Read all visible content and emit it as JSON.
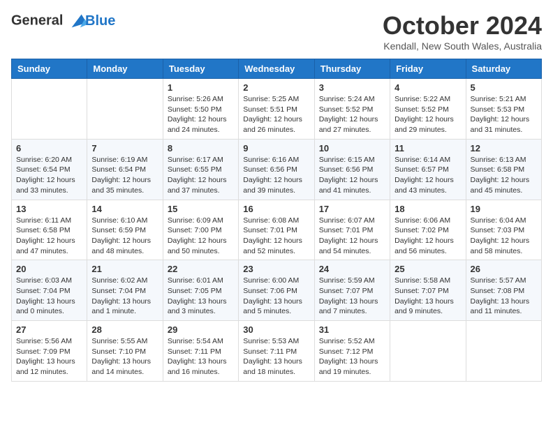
{
  "header": {
    "logo_line1": "General",
    "logo_line2": "Blue",
    "month": "October 2024",
    "location": "Kendall, New South Wales, Australia"
  },
  "weekdays": [
    "Sunday",
    "Monday",
    "Tuesday",
    "Wednesday",
    "Thursday",
    "Friday",
    "Saturday"
  ],
  "weeks": [
    [
      {
        "day": "",
        "sunrise": "",
        "sunset": "",
        "daylight": ""
      },
      {
        "day": "",
        "sunrise": "",
        "sunset": "",
        "daylight": ""
      },
      {
        "day": "1",
        "sunrise": "Sunrise: 5:26 AM",
        "sunset": "Sunset: 5:50 PM",
        "daylight": "Daylight: 12 hours and 24 minutes."
      },
      {
        "day": "2",
        "sunrise": "Sunrise: 5:25 AM",
        "sunset": "Sunset: 5:51 PM",
        "daylight": "Daylight: 12 hours and 26 minutes."
      },
      {
        "day": "3",
        "sunrise": "Sunrise: 5:24 AM",
        "sunset": "Sunset: 5:52 PM",
        "daylight": "Daylight: 12 hours and 27 minutes."
      },
      {
        "day": "4",
        "sunrise": "Sunrise: 5:22 AM",
        "sunset": "Sunset: 5:52 PM",
        "daylight": "Daylight: 12 hours and 29 minutes."
      },
      {
        "day": "5",
        "sunrise": "Sunrise: 5:21 AM",
        "sunset": "Sunset: 5:53 PM",
        "daylight": "Daylight: 12 hours and 31 minutes."
      }
    ],
    [
      {
        "day": "6",
        "sunrise": "Sunrise: 6:20 AM",
        "sunset": "Sunset: 6:54 PM",
        "daylight": "Daylight: 12 hours and 33 minutes."
      },
      {
        "day": "7",
        "sunrise": "Sunrise: 6:19 AM",
        "sunset": "Sunset: 6:54 PM",
        "daylight": "Daylight: 12 hours and 35 minutes."
      },
      {
        "day": "8",
        "sunrise": "Sunrise: 6:17 AM",
        "sunset": "Sunset: 6:55 PM",
        "daylight": "Daylight: 12 hours and 37 minutes."
      },
      {
        "day": "9",
        "sunrise": "Sunrise: 6:16 AM",
        "sunset": "Sunset: 6:56 PM",
        "daylight": "Daylight: 12 hours and 39 minutes."
      },
      {
        "day": "10",
        "sunrise": "Sunrise: 6:15 AM",
        "sunset": "Sunset: 6:56 PM",
        "daylight": "Daylight: 12 hours and 41 minutes."
      },
      {
        "day": "11",
        "sunrise": "Sunrise: 6:14 AM",
        "sunset": "Sunset: 6:57 PM",
        "daylight": "Daylight: 12 hours and 43 minutes."
      },
      {
        "day": "12",
        "sunrise": "Sunrise: 6:13 AM",
        "sunset": "Sunset: 6:58 PM",
        "daylight": "Daylight: 12 hours and 45 minutes."
      }
    ],
    [
      {
        "day": "13",
        "sunrise": "Sunrise: 6:11 AM",
        "sunset": "Sunset: 6:58 PM",
        "daylight": "Daylight: 12 hours and 47 minutes."
      },
      {
        "day": "14",
        "sunrise": "Sunrise: 6:10 AM",
        "sunset": "Sunset: 6:59 PM",
        "daylight": "Daylight: 12 hours and 48 minutes."
      },
      {
        "day": "15",
        "sunrise": "Sunrise: 6:09 AM",
        "sunset": "Sunset: 7:00 PM",
        "daylight": "Daylight: 12 hours and 50 minutes."
      },
      {
        "day": "16",
        "sunrise": "Sunrise: 6:08 AM",
        "sunset": "Sunset: 7:01 PM",
        "daylight": "Daylight: 12 hours and 52 minutes."
      },
      {
        "day": "17",
        "sunrise": "Sunrise: 6:07 AM",
        "sunset": "Sunset: 7:01 PM",
        "daylight": "Daylight: 12 hours and 54 minutes."
      },
      {
        "day": "18",
        "sunrise": "Sunrise: 6:06 AM",
        "sunset": "Sunset: 7:02 PM",
        "daylight": "Daylight: 12 hours and 56 minutes."
      },
      {
        "day": "19",
        "sunrise": "Sunrise: 6:04 AM",
        "sunset": "Sunset: 7:03 PM",
        "daylight": "Daylight: 12 hours and 58 minutes."
      }
    ],
    [
      {
        "day": "20",
        "sunrise": "Sunrise: 6:03 AM",
        "sunset": "Sunset: 7:04 PM",
        "daylight": "Daylight: 13 hours and 0 minutes."
      },
      {
        "day": "21",
        "sunrise": "Sunrise: 6:02 AM",
        "sunset": "Sunset: 7:04 PM",
        "daylight": "Daylight: 13 hours and 1 minute."
      },
      {
        "day": "22",
        "sunrise": "Sunrise: 6:01 AM",
        "sunset": "Sunset: 7:05 PM",
        "daylight": "Daylight: 13 hours and 3 minutes."
      },
      {
        "day": "23",
        "sunrise": "Sunrise: 6:00 AM",
        "sunset": "Sunset: 7:06 PM",
        "daylight": "Daylight: 13 hours and 5 minutes."
      },
      {
        "day": "24",
        "sunrise": "Sunrise: 5:59 AM",
        "sunset": "Sunset: 7:07 PM",
        "daylight": "Daylight: 13 hours and 7 minutes."
      },
      {
        "day": "25",
        "sunrise": "Sunrise: 5:58 AM",
        "sunset": "Sunset: 7:07 PM",
        "daylight": "Daylight: 13 hours and 9 minutes."
      },
      {
        "day": "26",
        "sunrise": "Sunrise: 5:57 AM",
        "sunset": "Sunset: 7:08 PM",
        "daylight": "Daylight: 13 hours and 11 minutes."
      }
    ],
    [
      {
        "day": "27",
        "sunrise": "Sunrise: 5:56 AM",
        "sunset": "Sunset: 7:09 PM",
        "daylight": "Daylight: 13 hours and 12 minutes."
      },
      {
        "day": "28",
        "sunrise": "Sunrise: 5:55 AM",
        "sunset": "Sunset: 7:10 PM",
        "daylight": "Daylight: 13 hours and 14 minutes."
      },
      {
        "day": "29",
        "sunrise": "Sunrise: 5:54 AM",
        "sunset": "Sunset: 7:11 PM",
        "daylight": "Daylight: 13 hours and 16 minutes."
      },
      {
        "day": "30",
        "sunrise": "Sunrise: 5:53 AM",
        "sunset": "Sunset: 7:11 PM",
        "daylight": "Daylight: 13 hours and 18 minutes."
      },
      {
        "day": "31",
        "sunrise": "Sunrise: 5:52 AM",
        "sunset": "Sunset: 7:12 PM",
        "daylight": "Daylight: 13 hours and 19 minutes."
      },
      {
        "day": "",
        "sunrise": "",
        "sunset": "",
        "daylight": ""
      },
      {
        "day": "",
        "sunrise": "",
        "sunset": "",
        "daylight": ""
      }
    ]
  ]
}
